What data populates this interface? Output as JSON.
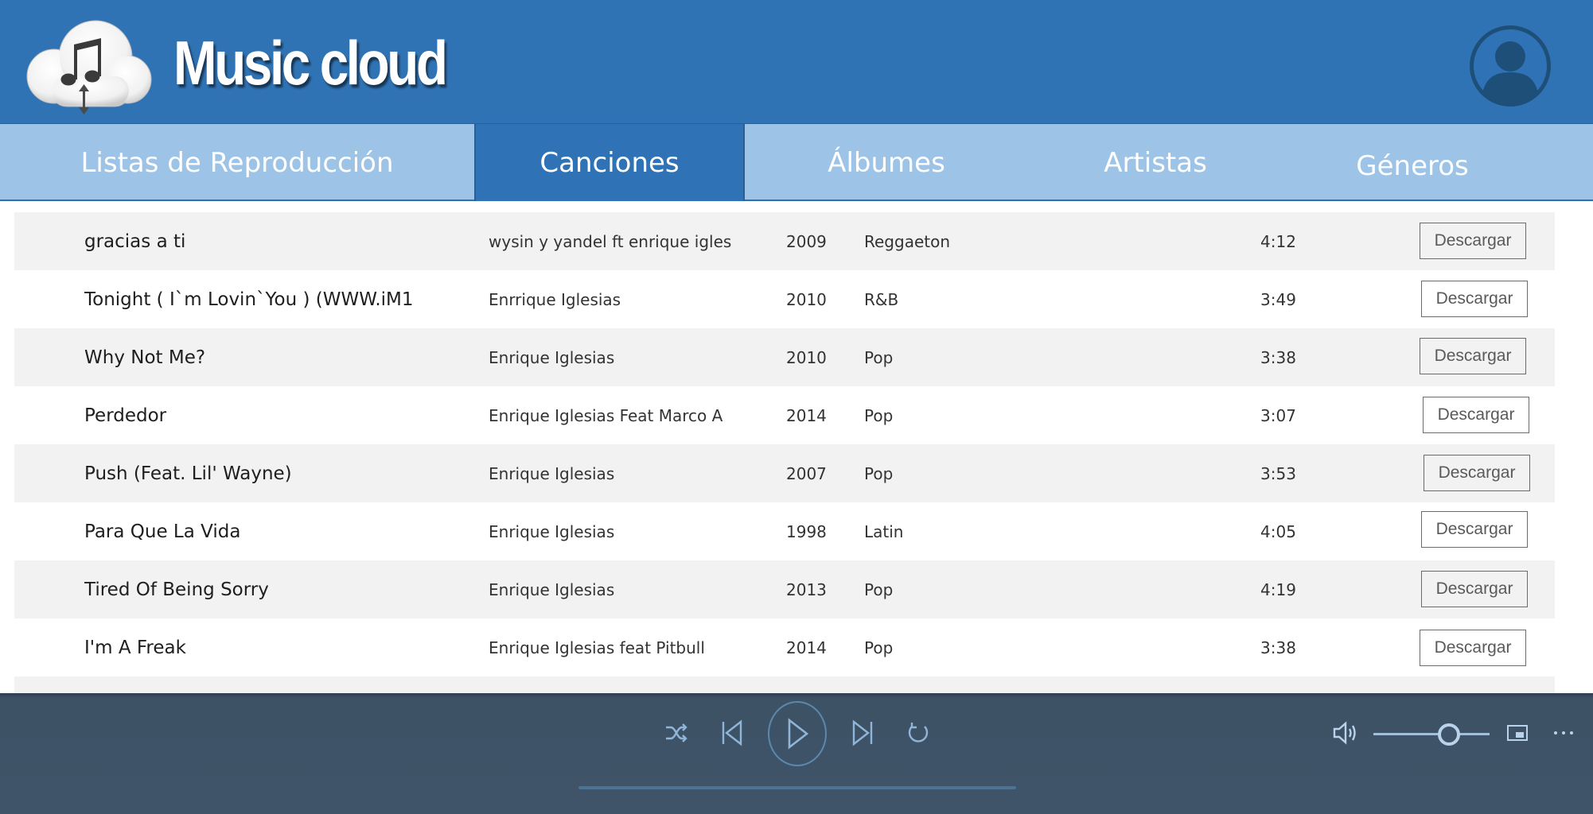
{
  "app": {
    "title": "Music cloud"
  },
  "tabs": [
    {
      "label": "Listas de Reproducción",
      "active": false
    },
    {
      "label": "Canciones",
      "active": true
    },
    {
      "label": "Álbumes",
      "active": false
    },
    {
      "label": "Artistas",
      "active": false
    },
    {
      "label": "Géneros",
      "active": false
    }
  ],
  "songs": [
    {
      "title": "gracias a ti",
      "artist": "wysin y yandel ft enrique igles",
      "year": "2009",
      "genre": "Reggaeton",
      "duration": "4:12",
      "action": "Descargar"
    },
    {
      "title": "Tonight ( I`m Lovin`You ) (WWW.iM1",
      "artist": "Enrrique Iglesias",
      "year": "2010",
      "genre": "R&B",
      "duration": "3:49",
      "action": "Descargar"
    },
    {
      "title": "Why Not Me?",
      "artist": "Enrique Iglesias",
      "year": "2010",
      "genre": "Pop",
      "duration": "3:38",
      "action": "Descargar"
    },
    {
      "title": "Perdedor",
      "artist": "Enrique Iglesias  Feat Marco A",
      "year": "2014",
      "genre": "Pop",
      "duration": "3:07",
      "action": "Descargar"
    },
    {
      "title": "Push (Feat. Lil' Wayne)",
      "artist": "Enrique Iglesias",
      "year": "2007",
      "genre": "Pop",
      "duration": "3:53",
      "action": "Descargar"
    },
    {
      "title": "Para Que La Vida",
      "artist": "Enrique Iglesias",
      "year": "1998",
      "genre": "Latin",
      "duration": "4:05",
      "action": "Descargar"
    },
    {
      "title": "Tired Of Being Sorry",
      "artist": "Enrique Iglesias",
      "year": "2013",
      "genre": "Pop",
      "duration": "4:19",
      "action": "Descargar"
    },
    {
      "title": "I'm A Freak",
      "artist": "Enrique Iglesias feat Pitbull",
      "year": "2014",
      "genre": "Pop",
      "duration": "3:38",
      "action": "Descargar"
    }
  ],
  "player": {
    "controls": [
      "shuffle-icon",
      "previous-icon",
      "play-icon",
      "next-icon",
      "repeat-icon"
    ],
    "volume_level": 0.65,
    "extra_controls": [
      "volume-icon",
      "mini-player-icon",
      "more-icon"
    ]
  },
  "colors": {
    "header": "#3073b4",
    "tabs": "#9dc3e6",
    "active_tab": "#2f72b5",
    "row_shade": "#f2f2f2",
    "player": "#3f5468",
    "player_accent": "#9fbfda"
  }
}
